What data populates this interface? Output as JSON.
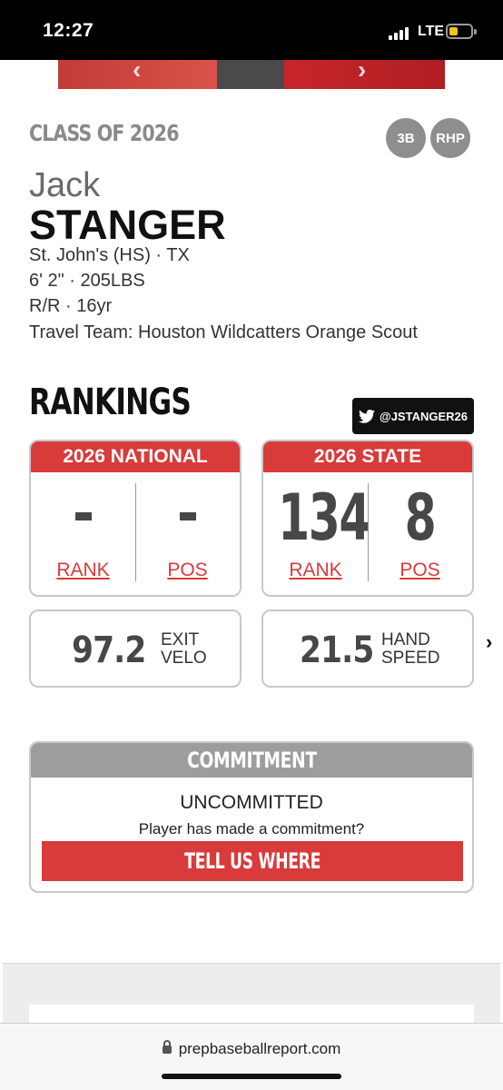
{
  "status_bar": {
    "time": "12:27",
    "network": "LTE",
    "battery_level": 0.4
  },
  "carousel": {
    "prev_icon": "chevron-left",
    "next_icon": "chevron-right"
  },
  "profile": {
    "class_of": "CLASS OF 2026",
    "positions": [
      "3B",
      "RHP"
    ],
    "first_name": "Jack",
    "last_name": "STANGER",
    "school": "St. John's (HS) · TX",
    "size": "6' 2\" · 205LBS",
    "bats_throws_age": "R/R · 16yr",
    "travel_team": "Travel Team: Houston Wildcatters Orange Scout"
  },
  "rankings": {
    "title": "RANKINGS",
    "twitter_handle": "@JSTANGER26",
    "national": {
      "title": "2026 NATIONAL",
      "rank": "-",
      "pos": "-",
      "rank_label": "RANK",
      "pos_label": "POS"
    },
    "state": {
      "title": "2026 STATE",
      "rank": "134",
      "pos": "8",
      "rank_label": "RANK",
      "pos_label": "POS"
    }
  },
  "stats": {
    "exit_velo": {
      "value": "97.2",
      "label_1": "EXIT",
      "label_2": "VELO"
    },
    "hand_speed": {
      "value": "21.5",
      "label_1": "HAND",
      "label_2": "SPEED"
    }
  },
  "commitment": {
    "title": "COMMITMENT",
    "status": "UNCOMMITTED",
    "question": "Player has made a commitment?",
    "button_label": "TELL US WHERE"
  },
  "browser": {
    "url": "prepbaseballreport.com"
  },
  "colors": {
    "accent": "#d93a3a",
    "header_gray": "#9d9d9d",
    "value_gray": "#474747"
  }
}
